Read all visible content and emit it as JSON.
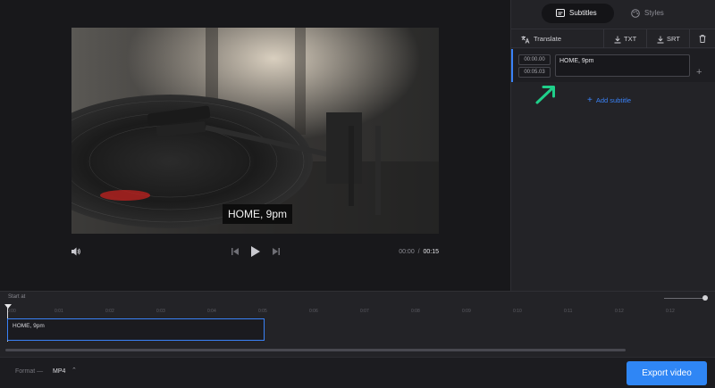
{
  "preview": {
    "caption": "HOME, 9pm",
    "time_current": "00:00",
    "time_separator": "/",
    "time_total": "00:15"
  },
  "sidepanel": {
    "tabs": [
      {
        "label": "Subtitles",
        "icon": "subtitles-icon",
        "active": true
      },
      {
        "label": "Styles",
        "icon": "palette-icon",
        "active": false
      }
    ],
    "toolbar": {
      "translate_label": "Translate",
      "txt_label": "TXT",
      "srt_label": "SRT"
    },
    "subtitles": [
      {
        "start": "00:00.00",
        "end": "00:05.03",
        "text": "HOME, 9pm"
      }
    ],
    "add_subtitle_label": "Add subtitle"
  },
  "timeline": {
    "start_at_label": "Start at",
    "ticks": [
      "0:00",
      "0:01",
      "0:02",
      "0:03",
      "0:04",
      "0:05",
      "0:06",
      "0:07",
      "0:08",
      "0:09",
      "0:10",
      "0:11",
      "0:12",
      "0:12"
    ],
    "clip_text": "HOME, 9pm"
  },
  "footer": {
    "format_label": "Format —",
    "format_value": "MP4",
    "export_label": "Export video"
  },
  "colors": {
    "accent": "#3a82f7",
    "annotation_arrow": "#1fd08a"
  }
}
